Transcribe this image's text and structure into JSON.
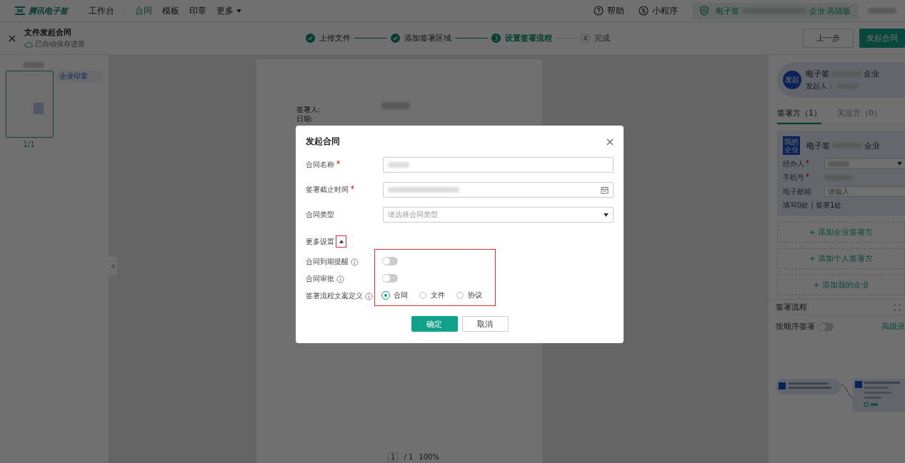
{
  "nav": {
    "logo": "腾讯电子签",
    "items": [
      {
        "label": "工作台",
        "selected": false,
        "dropdown": false
      },
      {
        "label": "合同",
        "selected": true,
        "dropdown": false
      },
      {
        "label": "模板",
        "selected": false,
        "dropdown": false
      },
      {
        "label": "印章",
        "selected": false,
        "dropdown": false
      },
      {
        "label": "更多",
        "selected": false,
        "dropdown": true
      }
    ],
    "help": "帮助",
    "mini_program": "小程序",
    "org_prefix": "电子签",
    "org_suffix": "企业·高级版"
  },
  "header": {
    "title": "文件发起合同",
    "autosave": "已自动保存进度",
    "steps": [
      {
        "label": "上传文件",
        "done": true,
        "current": false
      },
      {
        "label": "添加签署区域",
        "done": true,
        "current": false
      },
      {
        "number": "3",
        "label": "设置签署流程",
        "done": false,
        "current": true
      },
      {
        "number": "4",
        "label": "完成",
        "done": false,
        "current": false
      }
    ],
    "prev_button": "上一步",
    "submit_button": "发起合同"
  },
  "left_panel": {
    "seal_tag": "企业印章",
    "page_label": "1/1"
  },
  "document": {
    "fields": [
      "签署人:",
      "日期:"
    ],
    "pager": {
      "page": "1",
      "total": "/ 1",
      "zoom": "100%"
    }
  },
  "right_panel": {
    "initiator": {
      "badge": "发起",
      "org_prefix": "电子签",
      "org_suffix": "企业",
      "label": "发起人："
    },
    "tabs": [
      {
        "label": "签署方（1）",
        "selected": true
      },
      {
        "label": "关注方（0）",
        "selected": false
      }
    ],
    "signer": {
      "badge": "我的企业",
      "org_prefix": "电子签",
      "org_suffix": "企业",
      "fields": [
        {
          "label": "经办人",
          "required": true,
          "kind": "select"
        },
        {
          "label": "手机号",
          "required": true,
          "kind": "text"
        },
        {
          "label": "电子邮箱",
          "required": false,
          "kind": "input",
          "placeholder": "请输入"
        }
      ],
      "summary": "填写0处 | 签署1处"
    },
    "add_buttons": [
      "+ 添加企业签署方",
      "+ 添加个人签署方",
      "+ 添加我的企业"
    ],
    "flow": {
      "title": "签署流程",
      "sequential_label": "按顺序签署",
      "sequential": false,
      "advanced": "高级设"
    }
  },
  "dialog": {
    "title": "发起合同",
    "fields": [
      {
        "label": "合同名称",
        "required": true,
        "kind": "text"
      },
      {
        "label": "签署截止时间",
        "required": true,
        "kind": "date"
      },
      {
        "label": "合同类型",
        "required": false,
        "kind": "select",
        "placeholder": "请选择合同类型"
      }
    ],
    "more_settings": {
      "label": "更多设置",
      "expanded": true
    },
    "toggles": [
      {
        "label": "合同到期提醒",
        "on": false
      },
      {
        "label": "合同审批",
        "on": false
      }
    ],
    "wording": {
      "label": "签署流程文案定义",
      "options": [
        {
          "label": "合同",
          "selected": true
        },
        {
          "label": "文件",
          "selected": false
        },
        {
          "label": "协议",
          "selected": false
        }
      ]
    },
    "confirm": "确定",
    "cancel": "取消"
  }
}
